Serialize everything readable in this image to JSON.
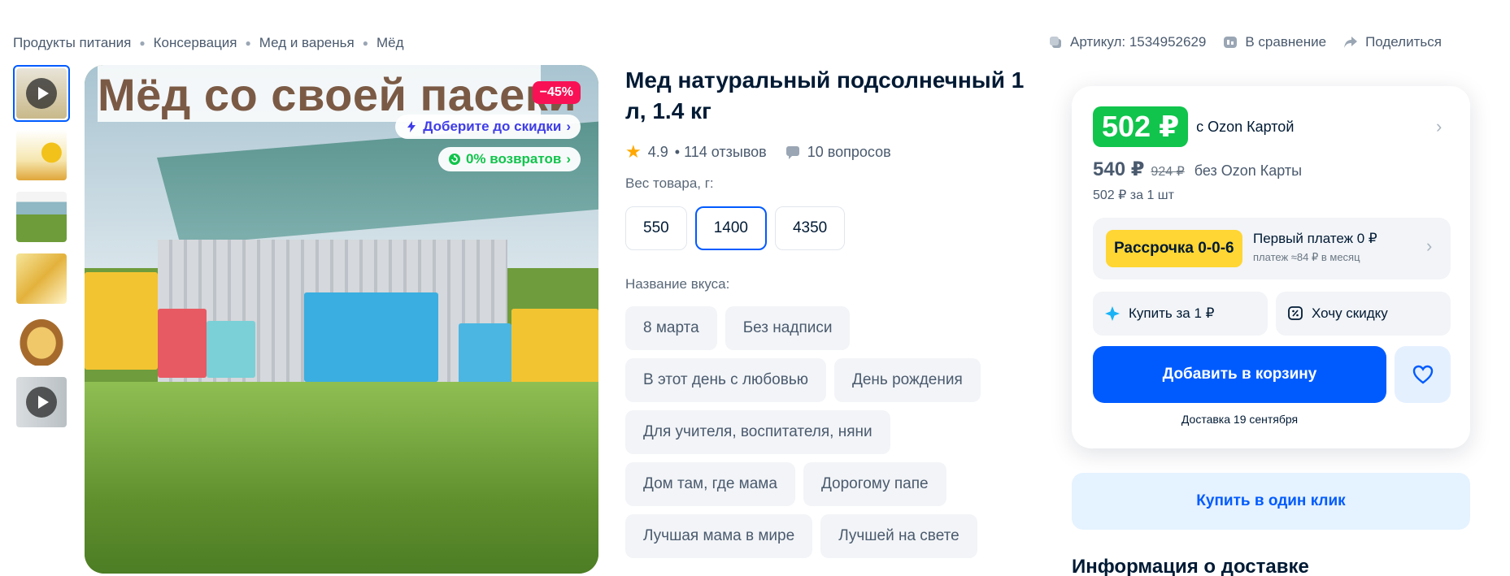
{
  "breadcrumbs": [
    "Продукты питания",
    "Консервация",
    "Мед и варенья",
    "Мёд"
  ],
  "top_actions": {
    "sku": "Артикул: 1534952629",
    "compare": "В сравнение",
    "share": "Поделиться"
  },
  "hero": {
    "banner_text": "Мёд со своей пасеки",
    "discount_badge": "−45%",
    "promo_discount": "Доберите до скидки",
    "promo_returns": "0% возвратов"
  },
  "product": {
    "title": "Мед натуральный подсолнечный 1 л, 1.4 кг",
    "rating": "4.9",
    "reviews": "• 114 отзывов",
    "questions": "10 вопросов",
    "weight_label": "Вес товара, г:",
    "weights": [
      "550",
      "1400",
      "4350"
    ],
    "selected_weight": "1400",
    "flavor_label": "Название вкуса:",
    "flavors": [
      "8 марта",
      "Без надписи",
      "В этот день с любовью",
      "День рождения",
      "Для учителя, воспитателя, няни",
      "Дом там, где мама",
      "Дорогому папе",
      "Лучшая мама в мире",
      "Лучшей на свете"
    ]
  },
  "buy": {
    "card_price": "502 ₽",
    "card_price_note": "с Ozon Картой",
    "price": "540 ₽",
    "old_price": "924 ₽",
    "no_card_note": "без Ozon Карты",
    "unit_price": "502 ₽ за 1 шт",
    "installment_tag": "Рассрочка 0-0-6",
    "installment_first": "Первый платеж 0 ₽",
    "installment_monthly": "платеж ≈84 ₽ в месяц",
    "buy_for_1": "Купить за 1 ₽",
    "want_discount": "Хочу скидку",
    "add_to_cart": "Добавить в корзину",
    "delivery": "Доставка 19 сентября",
    "one_click": "Купить в один клик",
    "delivery_info_heading": "Информация о доставке"
  },
  "colors": {
    "accent": "#005bff",
    "green": "#10c44c",
    "discount": "#f91155",
    "installment": "#ffd633"
  }
}
